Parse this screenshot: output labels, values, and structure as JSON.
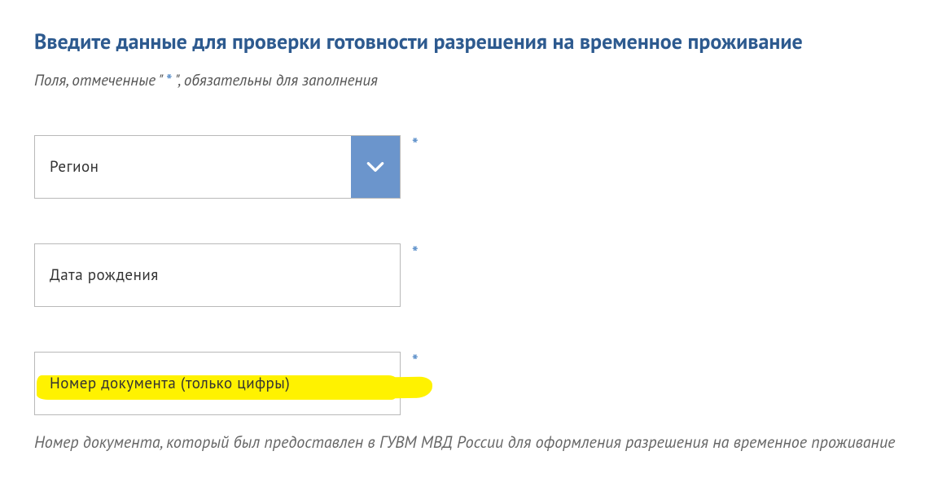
{
  "title": "Введите данные для проверки готовности разрешения на временное проживание",
  "hint_prefix": "Поля, отмеченные \"",
  "hint_asterisk": "*",
  "hint_suffix": "\", обязательны для заполнения",
  "required_mark": "*",
  "fields": {
    "region": {
      "label": "Регион"
    },
    "birthdate": {
      "label": "Дата рождения"
    },
    "docnumber": {
      "label": "Номер документа (только цифры)"
    }
  },
  "docnumber_help": "Номер документа, который был предоставлен в ГУВМ МВД России для оформления разрешения на временное проживание"
}
